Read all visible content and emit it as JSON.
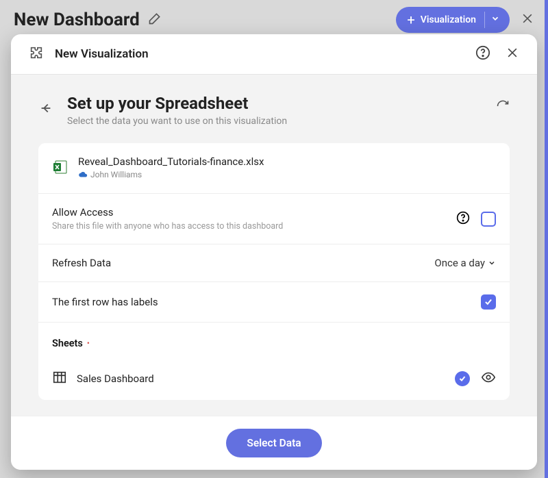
{
  "dashboard": {
    "title": "New Dashboard",
    "add_visualization_label": "Visualization"
  },
  "modal": {
    "title": "New Visualization",
    "step_title": "Set up your Spreadsheet",
    "step_subtitle": "Select the data you want to use on this visualization",
    "file": {
      "name": "Reveal_Dashboard_Tutorials-finance.xlsx",
      "owner": "John Williams"
    },
    "rows": {
      "allow_access_label": "Allow Access",
      "allow_access_sub": "Share this file with anyone who has access to this dashboard",
      "refresh_label": "Refresh Data",
      "refresh_value": "Once a day",
      "first_row_labels_label": "The first row has labels"
    },
    "sheets_heading": "Sheets",
    "sheets": [
      {
        "name": "Sales Dashboard",
        "selected": true
      }
    ],
    "footer_button": "Select Data"
  }
}
